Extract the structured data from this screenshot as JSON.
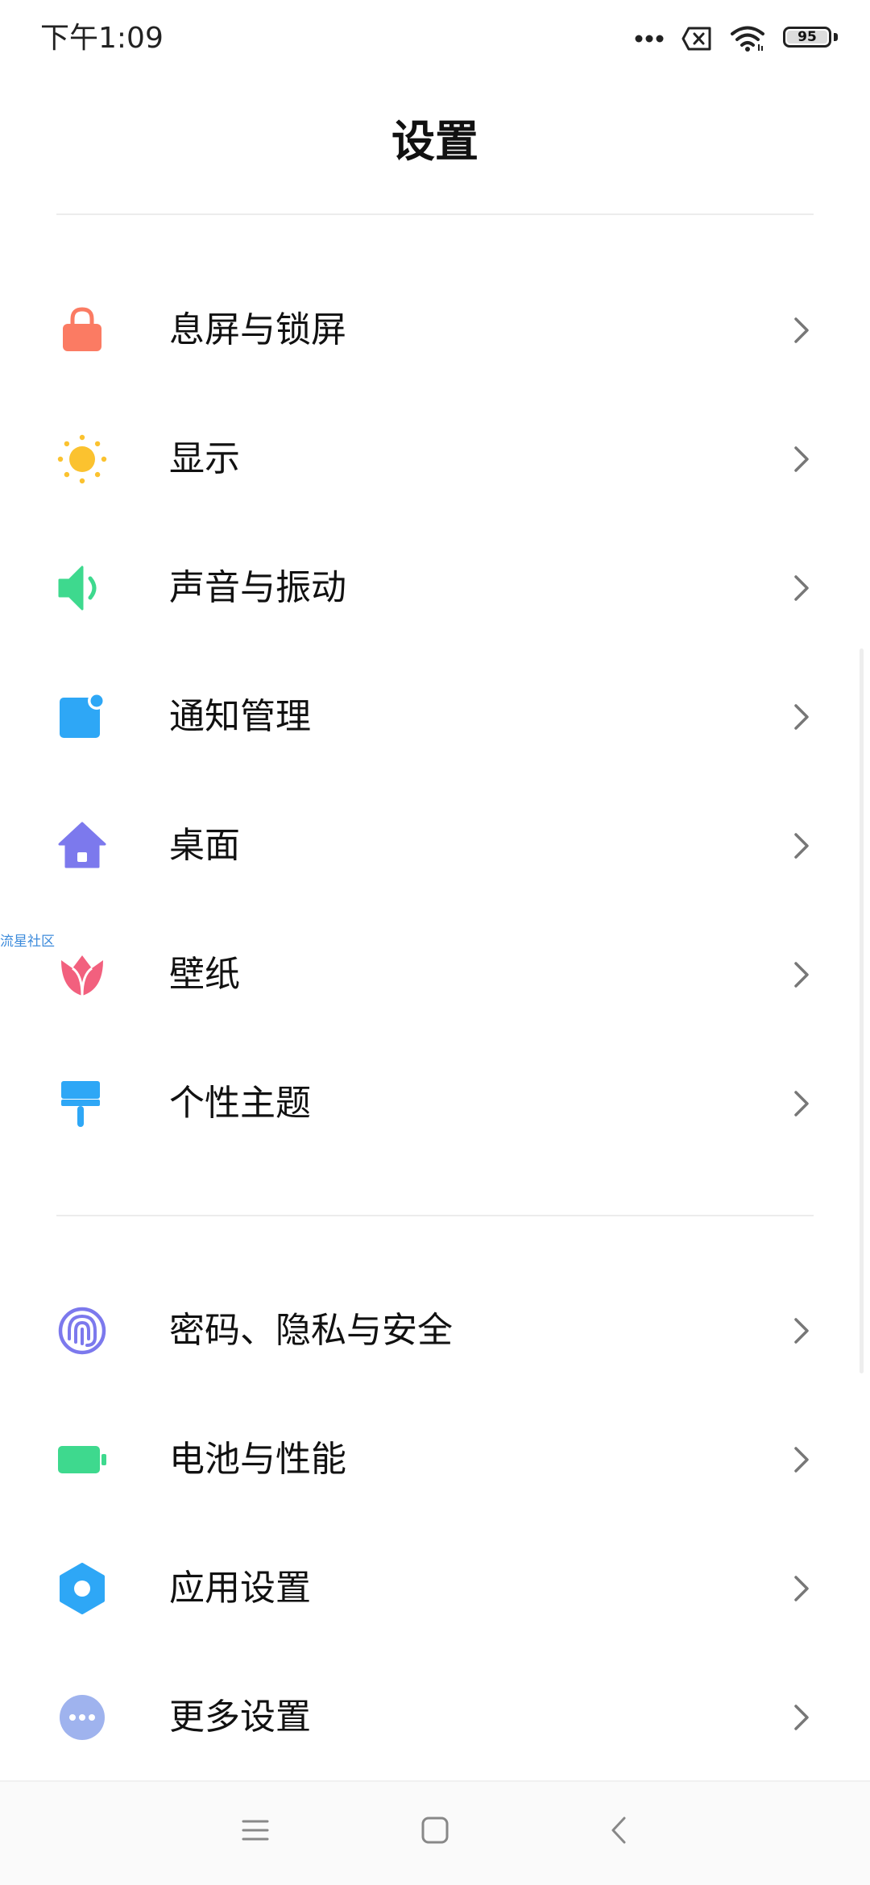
{
  "status_bar": {
    "time": "下午1:09",
    "battery_level": "95",
    "icons": [
      "more-dots-icon",
      "sim-x-icon",
      "wifi-icon",
      "battery-icon"
    ]
  },
  "header": {
    "title": "设置"
  },
  "groups": [
    {
      "items": [
        {
          "label": "息屏与锁屏",
          "icon": "lock-icon",
          "color": "#FB7B63"
        },
        {
          "label": "显示",
          "icon": "sun-icon",
          "color": "#FBC22F"
        },
        {
          "label": "声音与振动",
          "icon": "speaker-icon",
          "color": "#3ED98E"
        },
        {
          "label": "通知管理",
          "icon": "notification-icon",
          "color": "#2EA7F6"
        },
        {
          "label": "桌面",
          "icon": "home-icon",
          "color": "#7C79ED"
        },
        {
          "label": "壁纸",
          "icon": "tulip-icon",
          "color": "#F2607E"
        },
        {
          "label": "个性主题",
          "icon": "paintbrush-icon",
          "color": "#2EA7F6"
        }
      ]
    },
    {
      "items": [
        {
          "label": "密码、隐私与安全",
          "icon": "fingerprint-icon",
          "color": "#7C79ED"
        },
        {
          "label": "电池与性能",
          "icon": "battery-green-icon",
          "color": "#3ED98E"
        },
        {
          "label": "应用设置",
          "icon": "gear-icon",
          "color": "#2EA7F6"
        },
        {
          "label": "更多设置",
          "icon": "more-circle-icon",
          "color": "#9FB3EE"
        }
      ]
    }
  ],
  "watermark": "流星社区",
  "nav_bar": {
    "buttons": [
      "menu-icon",
      "home-square-icon",
      "back-icon"
    ]
  }
}
